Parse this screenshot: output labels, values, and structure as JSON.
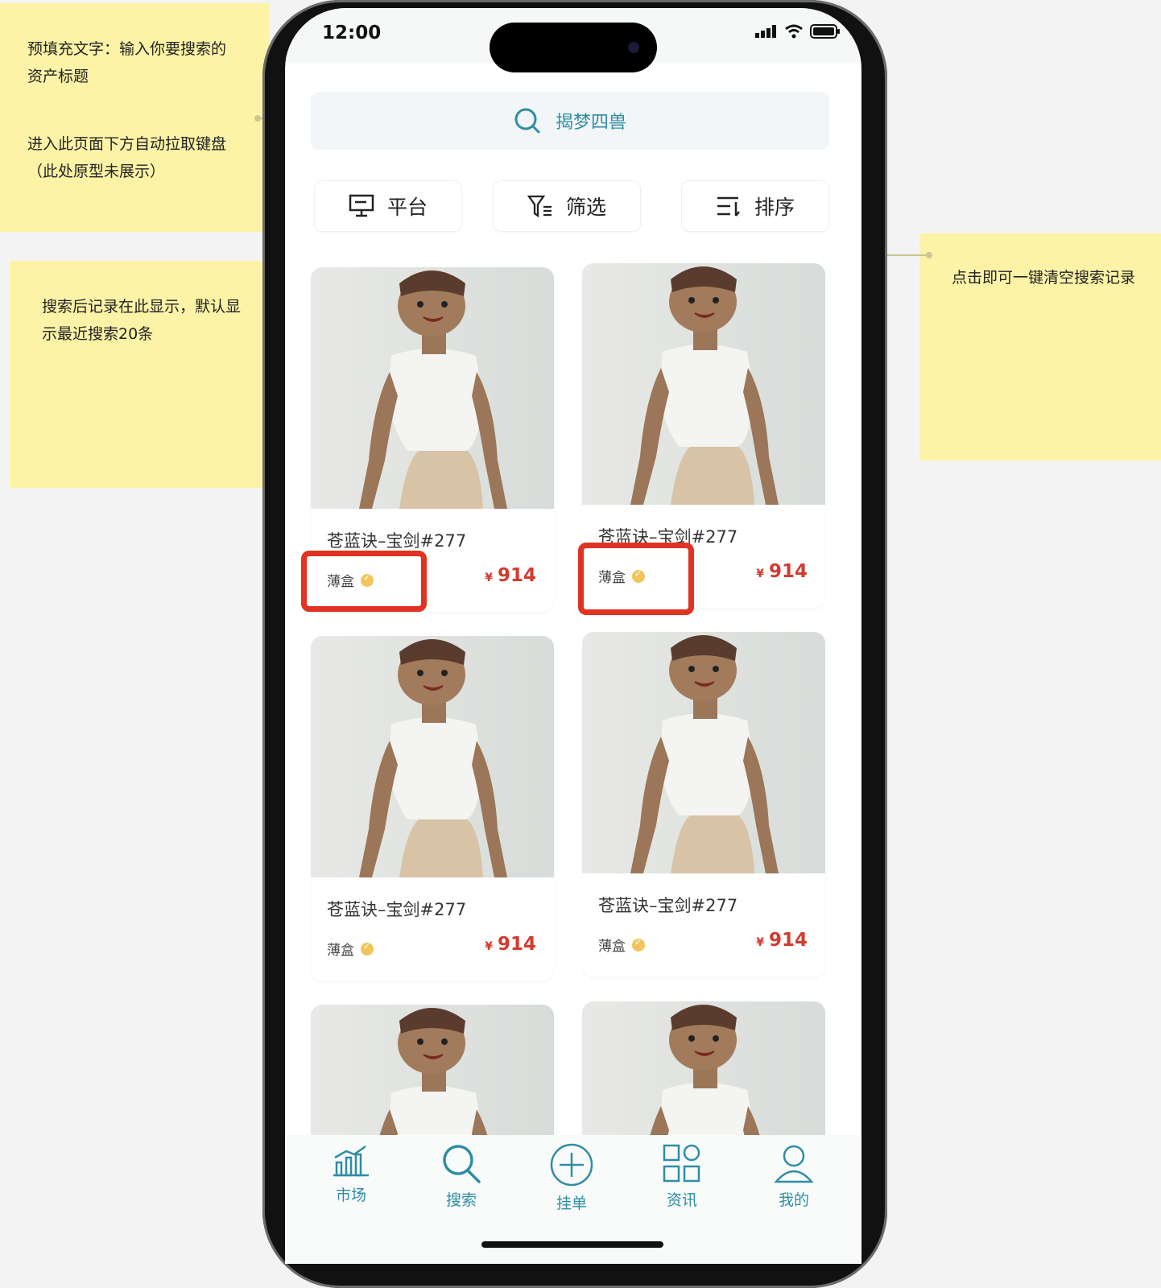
{
  "annotations": {
    "note_search_prefill": "预填充文字：输入你要搜索的\n资产标题",
    "note_keyboard": "进入此页面下方自动拉取键盘\n（此处原型未展示）",
    "note_history": "搜索后记录在此显示，默认显\n示最近搜索20条",
    "note_clear": "点击即可一键清空搜索记录"
  },
  "status_bar": {
    "time": "12:00"
  },
  "search": {
    "placeholder": "揭梦四兽"
  },
  "filters": {
    "platform": "平台",
    "filter": "筛选",
    "sort": "排序"
  },
  "products": [
    {
      "title": "苍蓝诀–宝剑#277",
      "platform": "薄盒",
      "currency": "¥",
      "price": "914"
    },
    {
      "title": "苍蓝诀–宝剑#277",
      "platform": "薄盒",
      "currency": "¥",
      "price": "914"
    },
    {
      "title": "苍蓝诀–宝剑#277",
      "platform": "薄盒",
      "currency": "¥",
      "price": "914"
    },
    {
      "title": "苍蓝诀–宝剑#277",
      "platform": "薄盒",
      "currency": "¥",
      "price": "914"
    },
    {
      "title": "",
      "platform": "",
      "currency": "",
      "price": ""
    },
    {
      "title": "",
      "platform": "",
      "currency": "",
      "price": ""
    }
  ],
  "tabs": {
    "market": "市场",
    "search": "搜索",
    "list": "挂单",
    "news": "资讯",
    "mine": "我的"
  },
  "colors": {
    "accent": "#2f8da3",
    "price": "#d23b2f",
    "note": "#fdf3a7",
    "highlight": "#e03321"
  }
}
